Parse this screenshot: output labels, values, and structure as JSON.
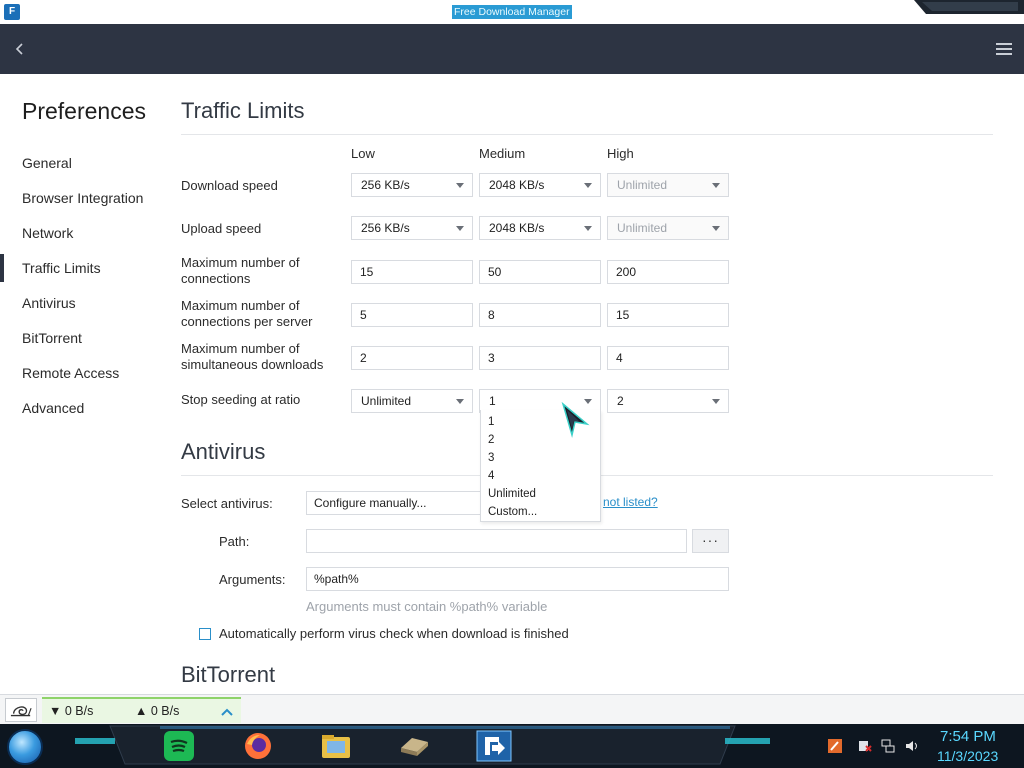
{
  "window": {
    "title": "Free Download Manager"
  },
  "sidebar": {
    "title": "Preferences",
    "items": [
      {
        "label": "General"
      },
      {
        "label": "Browser Integration"
      },
      {
        "label": "Network"
      },
      {
        "label": "Traffic Limits",
        "active": true
      },
      {
        "label": "Antivirus"
      },
      {
        "label": "BitTorrent"
      },
      {
        "label": "Remote Access"
      },
      {
        "label": "Advanced"
      }
    ]
  },
  "traffic": {
    "title": "Traffic Limits",
    "columns": [
      "Low",
      "Medium",
      "High"
    ],
    "rows": [
      {
        "label": "Download speed",
        "type": "select",
        "values": [
          "256 KB/s",
          "2048 KB/s",
          "Unlimited"
        ]
      },
      {
        "label": "Upload speed",
        "type": "select",
        "values": [
          "256 KB/s",
          "2048 KB/s",
          "Unlimited"
        ]
      },
      {
        "label": "Maximum number of connections",
        "type": "input",
        "values": [
          "15",
          "50",
          "200"
        ]
      },
      {
        "label": "Maximum number of connections per server",
        "type": "input",
        "values": [
          "5",
          "8",
          "15"
        ]
      },
      {
        "label": "Maximum number of simultaneous downloads",
        "type": "input",
        "values": [
          "2",
          "3",
          "4"
        ]
      },
      {
        "label": "Stop seeding at ratio",
        "type": "select",
        "values": [
          "Unlimited",
          "1",
          "2"
        ]
      }
    ],
    "dropdown_options": [
      "1",
      "2",
      "3",
      "4",
      "Unlimited",
      "Custom..."
    ]
  },
  "antivirus": {
    "title": "Antivirus",
    "select_label": "Select antivirus:",
    "select_value": "Configure manually...",
    "not_listed_link": "not listed?",
    "path_label": "Path:",
    "path_value": "",
    "browse_label": "···",
    "args_label": "Arguments:",
    "args_value": "%path%",
    "args_hint": "Arguments must contain %path% variable",
    "auto_check_label": "Automatically perform virus check when download is finished",
    "auto_check_checked": false
  },
  "bittorrent": {
    "title": "BitTorrent"
  },
  "statusbar": {
    "download_speed": "▼ 0 B/s",
    "upload_speed": "▲ 0 B/s"
  },
  "taskbar": {
    "time": "7:54 PM",
    "date": "11/3/2023",
    "apps": [
      "spotify-icon",
      "firefox-icon",
      "file-manager-icon",
      "drive-icon",
      "fdm-icon"
    ]
  },
  "colors": {
    "header": "#2d3443",
    "accent": "#2a8fc9",
    "speed_panel": "#eaf7e3"
  }
}
